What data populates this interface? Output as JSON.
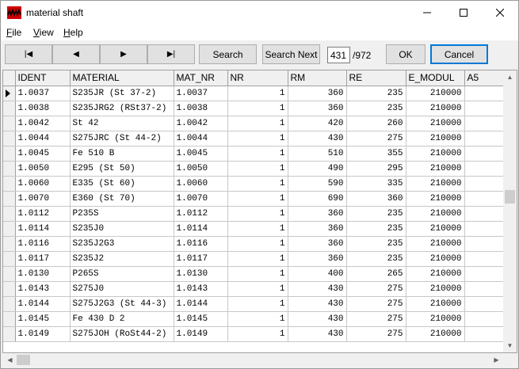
{
  "window": {
    "title": "material shaft",
    "minimize": "—",
    "maximize": "☐",
    "close": "✕"
  },
  "menu": [
    {
      "underline": "F",
      "rest": "ile"
    },
    {
      "underline": "V",
      "rest": "iew"
    },
    {
      "underline": "H",
      "rest": "elp"
    }
  ],
  "toolbar": {
    "first": "|◀",
    "prev": "◀",
    "next": "▶",
    "last": "▶|",
    "search": "Search",
    "search_next": "Search Next",
    "record_value": "431",
    "record_total": "/972",
    "ok": "OK",
    "cancel": "Cancel"
  },
  "grid": {
    "columns": [
      "IDENT",
      "MATERIAL",
      "MAT_NR",
      "NR",
      "RM",
      "RE",
      "E_MODUL",
      "A5"
    ],
    "current_row": 0,
    "rows": [
      [
        "1.0037",
        "S235JR (St 37-2)",
        "1.0037",
        "1",
        "360",
        "235",
        "210000",
        ""
      ],
      [
        "1.0038",
        "S235JRG2 (RSt37-2)",
        "1.0038",
        "1",
        "360",
        "235",
        "210000",
        ""
      ],
      [
        "1.0042",
        "St 42",
        "1.0042",
        "1",
        "420",
        "260",
        "210000",
        ""
      ],
      [
        "1.0044",
        "S275JRC (St 44-2)",
        "1.0044",
        "1",
        "430",
        "275",
        "210000",
        ""
      ],
      [
        "1.0045",
        "Fe 510 B",
        "1.0045",
        "1",
        "510",
        "355",
        "210000",
        ""
      ],
      [
        "1.0050",
        "E295 (St 50)",
        "1.0050",
        "1",
        "490",
        "295",
        "210000",
        ""
      ],
      [
        "1.0060",
        "E335 (St 60)",
        "1.0060",
        "1",
        "590",
        "335",
        "210000",
        ""
      ],
      [
        "1.0070",
        "E360 (St 70)",
        "1.0070",
        "1",
        "690",
        "360",
        "210000",
        ""
      ],
      [
        "1.0112",
        "P235S",
        "1.0112",
        "1",
        "360",
        "235",
        "210000",
        ""
      ],
      [
        "1.0114",
        "S235J0",
        "1.0114",
        "1",
        "360",
        "235",
        "210000",
        ""
      ],
      [
        "1.0116",
        "S235J2G3",
        "1.0116",
        "1",
        "360",
        "235",
        "210000",
        ""
      ],
      [
        "1.0117",
        "S235J2",
        "1.0117",
        "1",
        "360",
        "235",
        "210000",
        ""
      ],
      [
        "1.0130",
        "P265S",
        "1.0130",
        "1",
        "400",
        "265",
        "210000",
        ""
      ],
      [
        "1.0143",
        "S275J0",
        "1.0143",
        "1",
        "430",
        "275",
        "210000",
        ""
      ],
      [
        "1.0144",
        "S275J2G3 (St 44-3)",
        "1.0144",
        "1",
        "430",
        "275",
        "210000",
        ""
      ],
      [
        "1.0145",
        "Fe 430 D 2",
        "1.0145",
        "1",
        "430",
        "275",
        "210000",
        ""
      ],
      [
        "1.0149",
        "S275JOH (RoSt44-2)",
        "1.0149",
        "1",
        "430",
        "275",
        "210000",
        ""
      ]
    ]
  },
  "scrollbar": {
    "vertical_position": 0.44,
    "horizontal_position": 0.0
  }
}
